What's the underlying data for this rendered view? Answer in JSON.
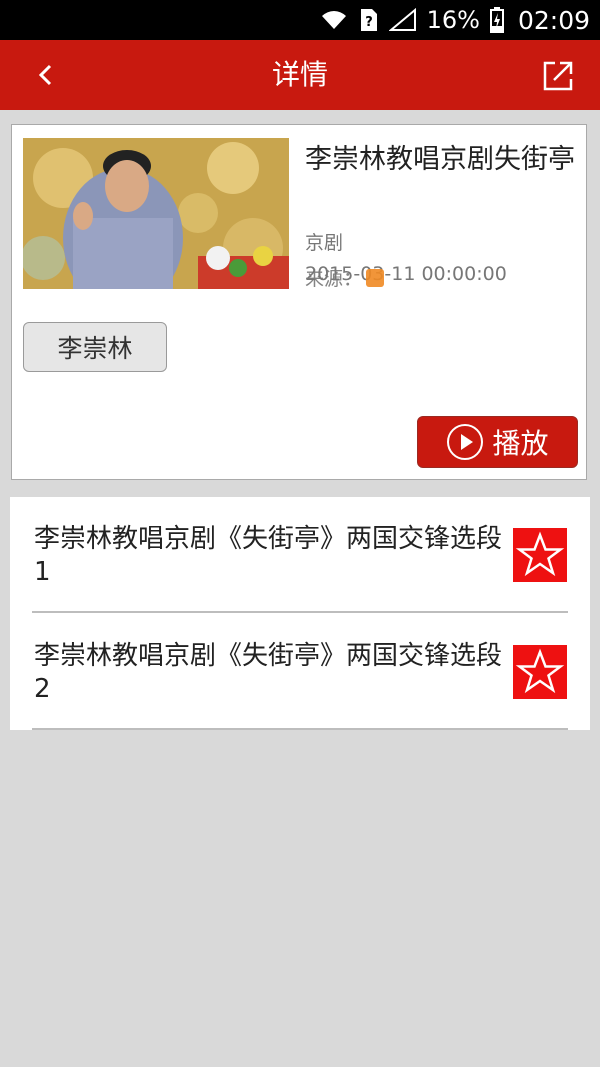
{
  "status_bar": {
    "battery": "16%",
    "time": "02:09"
  },
  "app_bar": {
    "title": "详情",
    "back_icon": "chevron-left-icon",
    "share_icon": "external-share-icon"
  },
  "detail": {
    "title": "李崇林教唱京剧失街亭",
    "category": "京剧",
    "date": "2015-03-11 00:00:00",
    "source_label": "来源：",
    "artist": "李崇林",
    "play_label": "播放"
  },
  "episodes": [
    {
      "title": "李崇林教唱京剧《失街亭》两国交锋选段 1"
    },
    {
      "title": "李崇林教唱京剧《失街亭》两国交锋选段 2"
    }
  ],
  "colors": {
    "brand_red": "#c8190f",
    "star_red": "#ee1111"
  }
}
